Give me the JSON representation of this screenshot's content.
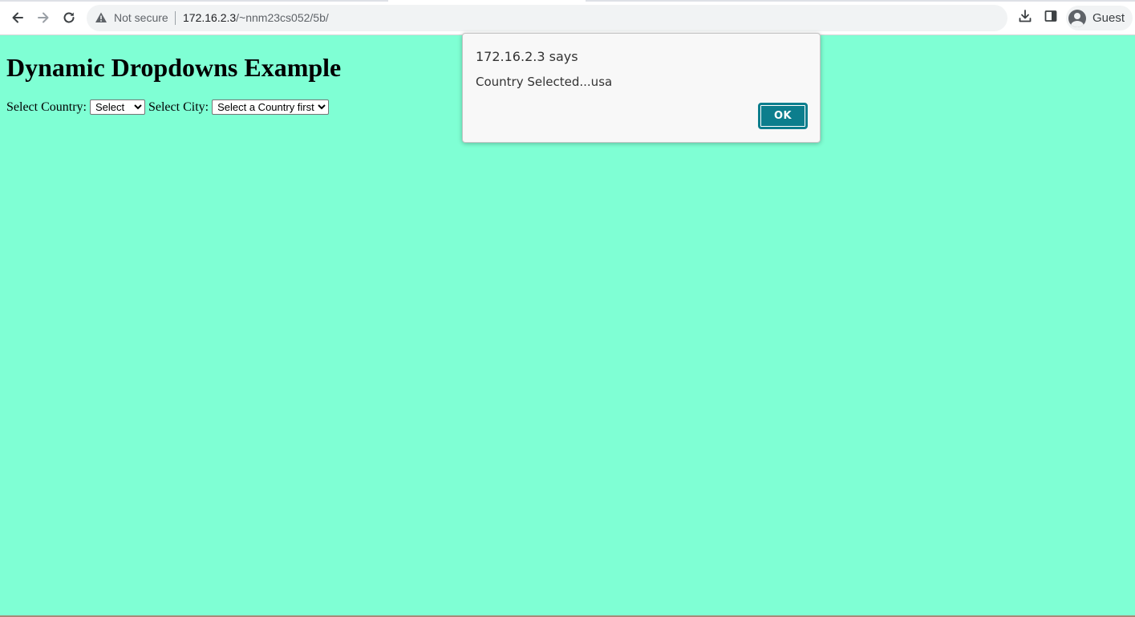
{
  "browser": {
    "security_label": "Not secure",
    "url_host": "172.16.2.3",
    "url_path": "/~nnm23cs052/5b/",
    "profile_label": "Guest",
    "icons": [
      "back-icon",
      "forward-icon",
      "reload-icon",
      "warning-icon",
      "download-icon",
      "side-panel-icon",
      "profile-avatar-icon"
    ]
  },
  "page": {
    "background_color": "#7fffd4",
    "heading": "Dynamic Dropdowns Example",
    "country_label": "Select Country:",
    "country_selected": "Select",
    "city_label": "Select City:",
    "city_selected": "Select a Country first"
  },
  "dialog": {
    "title": "172.16.2.3 says",
    "message": "Country Selected...usa",
    "ok_label": "OK",
    "ok_color": "#0c7e8d"
  }
}
